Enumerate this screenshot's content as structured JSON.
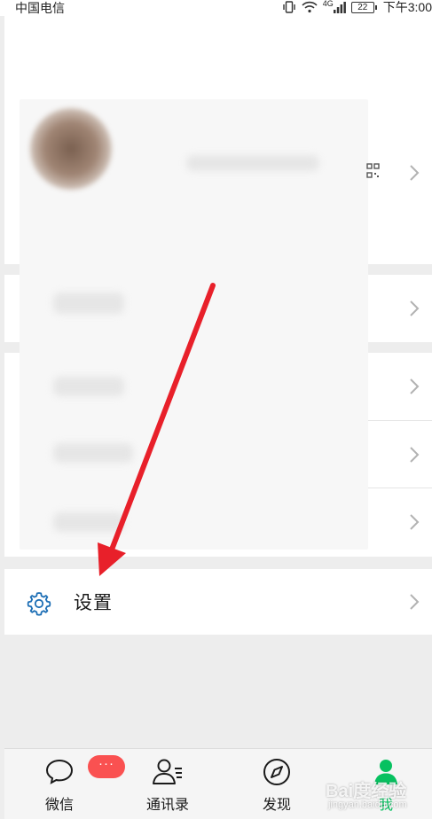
{
  "status_bar": {
    "carrier": "中国电信",
    "network": "4G",
    "battery": "22",
    "time": "下午3:00"
  },
  "settings": {
    "label": "设置"
  },
  "tabbar": {
    "tabs": [
      {
        "label": "微信",
        "icon": "chat-bubble-icon",
        "badge": "···"
      },
      {
        "label": "通讯录",
        "icon": "contacts-icon"
      },
      {
        "label": "发现",
        "icon": "compass-icon"
      },
      {
        "label": "我",
        "icon": "person-icon",
        "active": true
      }
    ]
  },
  "watermark": {
    "text": "Bai度经验",
    "sub": "jingyan.baidu.com"
  },
  "colors": {
    "accent": "#07c160",
    "badge": "#fa5151",
    "arrow": "#e8202a",
    "icon_blue": "#1e6fb5"
  }
}
